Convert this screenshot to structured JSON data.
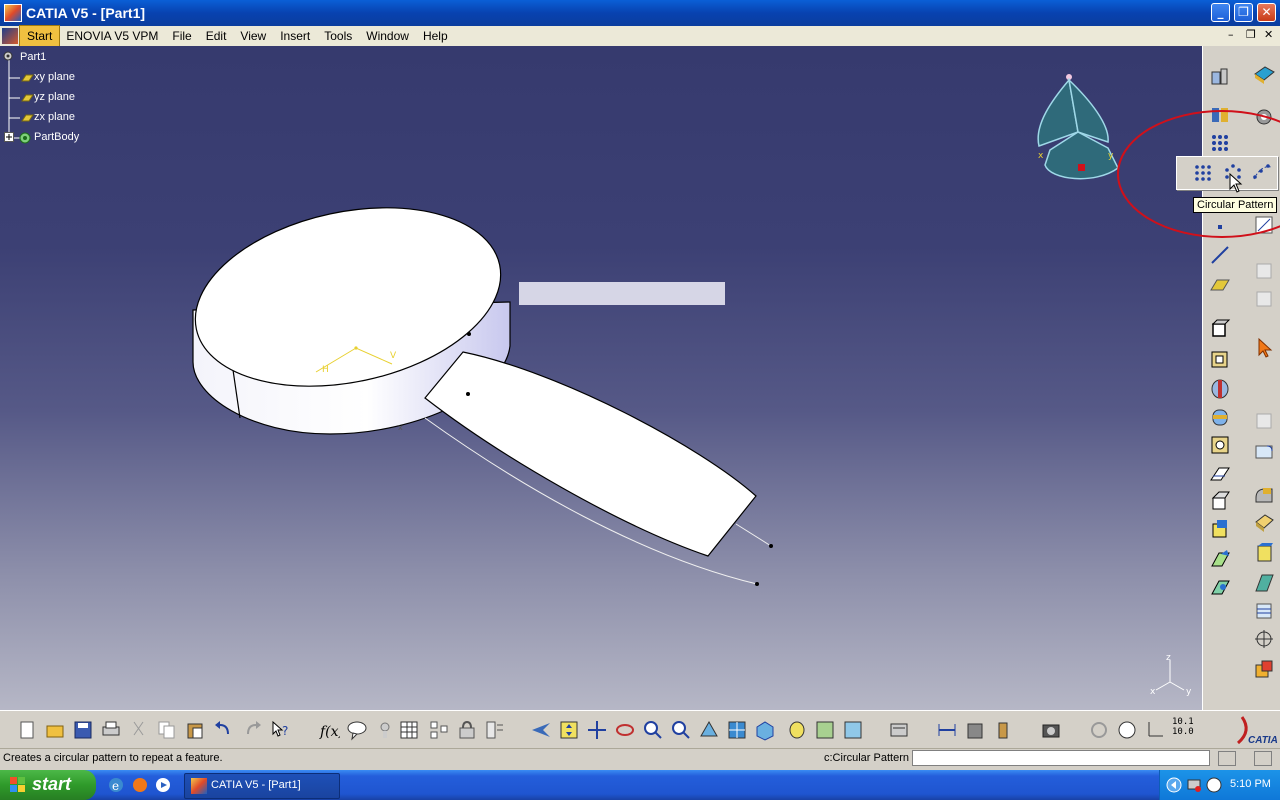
{
  "window": {
    "title": "CATIA V5 - [Part1]",
    "minimize_glyph": "_",
    "restore_glyph": "❐",
    "close_glyph": "✕",
    "mdi_minimize_glyph": "–",
    "mdi_restore_glyph": "❐",
    "mdi_close_glyph": "✕"
  },
  "menubar": {
    "items": [
      "Start",
      "ENOVIA V5 VPM",
      "File",
      "Edit",
      "View",
      "Insert",
      "Tools",
      "Window",
      "Help"
    ]
  },
  "tree": {
    "root": "Part1",
    "children": [
      "xy plane",
      "yz plane",
      "zx plane",
      "PartBody"
    ]
  },
  "compass": {
    "x_label": "x",
    "y_label": "y"
  },
  "axis_triad": {
    "x": "x",
    "y": "y",
    "z": "z"
  },
  "sketch": {
    "h_label": "H",
    "v_label": "V"
  },
  "floating_toolbar": {
    "tooltip": "Circular Pattern",
    "icons": [
      "rectangular-pattern-icon",
      "circular-pattern-icon",
      "user-pattern-icon"
    ]
  },
  "right_toolbar": {
    "icons": [
      "sketcher-icon",
      "part-design-icon",
      "multi-sketch-icon",
      "pattern-icon",
      "point-icon",
      "line-icon",
      "plane-icon",
      "pad-icon",
      "pocket-icon",
      "shaft-icon",
      "groove-icon",
      "hole-icon",
      "rib-icon",
      "slot-icon",
      "stiffener-icon",
      "multi-section-solid-icon",
      "removed-multi-section-icon",
      "select-icon",
      "fillet-icon",
      "chamfer-icon",
      "draft-icon",
      "shell-icon",
      "thickness-icon",
      "thread-icon",
      "axis-system-icon",
      "boolean-icon",
      "tools-icon"
    ]
  },
  "bottom_toolbar": {
    "icons": [
      "new-icon",
      "open-icon",
      "save-icon",
      "print-icon",
      "cut-icon",
      "copy-icon",
      "paste-icon",
      "undo-icon",
      "redo-icon",
      "whats-this-icon",
      "formula-icon",
      "comment-icon",
      "knowledge-icon",
      "table-icon",
      "update-icon",
      "lock-icon",
      "parameters-icon",
      "fly-mode-icon",
      "fit-all-icon",
      "pan-icon",
      "rotate-icon",
      "zoom-in-icon",
      "zoom-out-icon",
      "normal-view-icon",
      "multi-view-icon",
      "iso-view-icon",
      "render-style-icon",
      "hide-show-icon",
      "swap-visible-icon",
      "catalog-icon",
      "measure-icon",
      "inertia-icon",
      "apply-material-icon",
      "capture-icon",
      "refresh-icon",
      "hand-icon",
      "axis-icon",
      "scale-icon"
    ],
    "scale_text_top": "10.1",
    "scale_text_bottom": "10.0"
  },
  "status": {
    "message": "Creates a circular pattern to repeat a feature.",
    "command": "c:Circular Pattern",
    "command_input_placeholder": ""
  },
  "taskbar": {
    "start_label": "start",
    "task_label": "CATIA V5 - [Part1]",
    "clock": "5:10 PM"
  },
  "colors": {
    "title_blue": "#0a4fc8",
    "viewport_top": "#363a6e",
    "viewport_bottom": "#b6b7c6",
    "highlight_red": "#d0101a",
    "tooltip_bg": "#ffffe1",
    "compass_fill": "#2f6a7a"
  },
  "brand": "CATIA"
}
